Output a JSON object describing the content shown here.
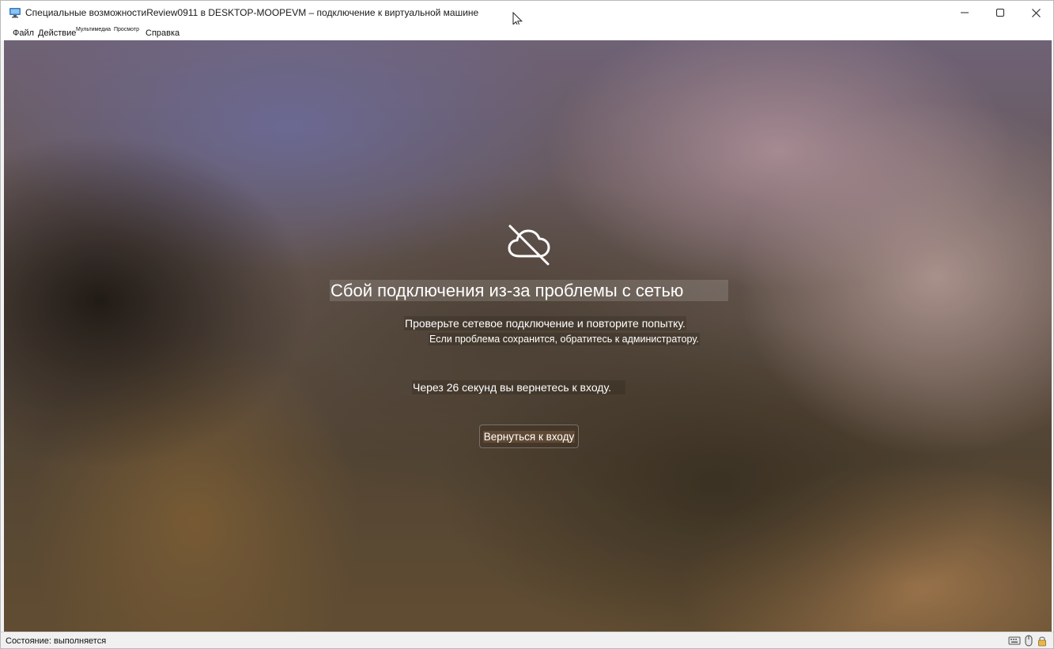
{
  "window": {
    "title": "Специальные возможностиReview0911 в DESKTOP-MOOPEVM – подключение к виртуальной машине",
    "icon": "vm-connect-icon"
  },
  "title_buttons": {
    "minimize": "minimize-icon",
    "maximize": "maximize-icon",
    "close": "close-icon"
  },
  "menu": {
    "file": "Файл",
    "action": "Действие",
    "media": "Мультимедиа",
    "view": "Просмотр",
    "help": "Справка"
  },
  "vm": {
    "icon": "cloud-off-icon",
    "error_title": "Сбой подключения из-за проблемы с сетью",
    "error_line1": "Проверьте сетевое подключение и повторите попытку.",
    "error_line2": "Если проблема сохранится, обратитесь к администратору.",
    "countdown": "Через 26 секунд вы вернетесь к входу.",
    "return_button": "Вернуться к входу"
  },
  "status": {
    "text": "Состояние: выполняется",
    "tray_icons": [
      "keyboard-icon",
      "mouse-icon",
      "lock-icon"
    ]
  }
}
